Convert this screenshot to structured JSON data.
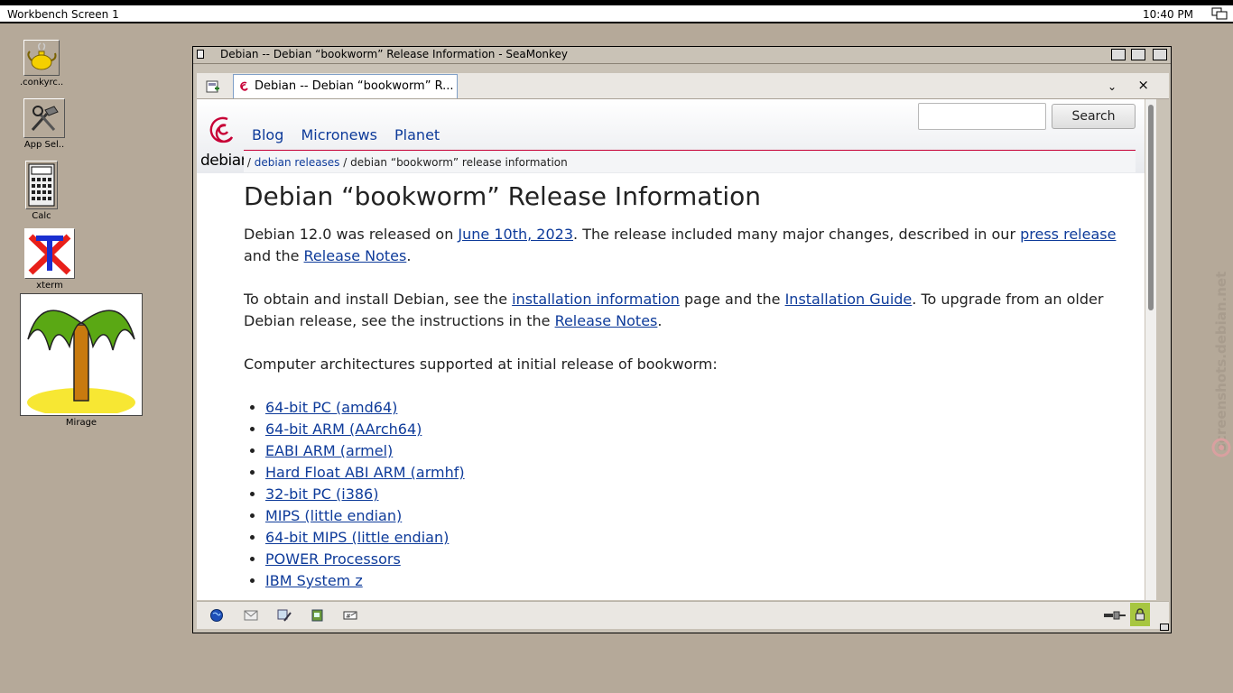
{
  "screen": {
    "title": "Workbench Screen 1",
    "clock": "10:40 PM"
  },
  "desktop_icons": [
    {
      "label": ".conkyrc.."
    },
    {
      "label": "App Sel.."
    },
    {
      "label": "Calc"
    },
    {
      "label": "xterm"
    },
    {
      "label": "Mirage"
    }
  ],
  "window": {
    "title": "Debian -- Debian “bookworm” Release Information - SeaMonkey"
  },
  "tab": {
    "title": "Debian -- Debian “bookworm” R..."
  },
  "site": {
    "logo_text": "debian",
    "nav": [
      "Blog",
      "Micronews",
      "Planet"
    ],
    "search_button": "Search",
    "search_value": ""
  },
  "breadcrumb": {
    "sep1": "/",
    "link": "debian releases",
    "current": "/ debian “bookworm” release information"
  },
  "article": {
    "heading": "Debian “bookworm” Release Information",
    "p1": {
      "t1": "Debian 12.0 was released on ",
      "link1": "June 10th, 2023",
      "t2": ". The release included many major changes, described in our ",
      "link2": "press release",
      "t3": " and the ",
      "link3": "Release Notes",
      "t4": "."
    },
    "p2": {
      "t1": "To obtain and install Debian, see the ",
      "link1": "installation information",
      "t2": " page and the ",
      "link2": "Installation Guide",
      "t3": ". To upgrade from an older Debian release, see the instructions in the ",
      "link3": "Release Notes",
      "t4": "."
    },
    "p3": "Computer architectures supported at initial release of bookworm:",
    "architectures": [
      "64-bit PC (amd64)",
      "64-bit ARM (AArch64)",
      "EABI ARM (armel)",
      "Hard Float ABI ARM (armhf)",
      "32-bit PC (i386)",
      "MIPS (little endian)",
      "64-bit MIPS (little endian)",
      "POWER Processors",
      "IBM System z"
    ]
  },
  "watermark": "screenshots.debian.net",
  "colors": {
    "desktop": "#b5a999",
    "link": "#0e3b9a",
    "debian_red": "#c70036",
    "lock_green": "#a7c640"
  }
}
